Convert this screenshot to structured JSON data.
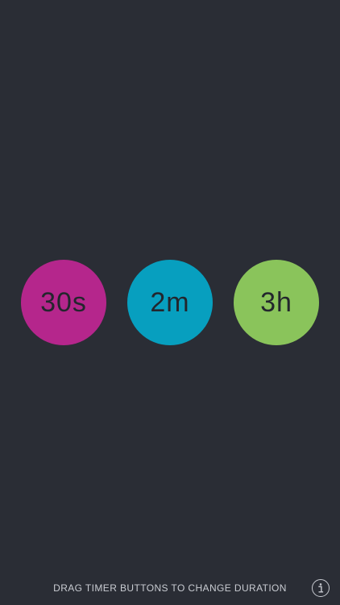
{
  "timers": [
    {
      "label": "30s",
      "color": "#b5268c"
    },
    {
      "label": "2m",
      "color": "#079fbf"
    },
    {
      "label": "3h",
      "color": "#8ac45b"
    }
  ],
  "footer": {
    "hint": "DRAG TIMER BUTTONS TO CHANGE DURATION",
    "info_icon": "info-icon"
  },
  "colors": {
    "background": "#2a2d35",
    "label_text": "#23262d",
    "hint_text": "#c9ccd2"
  }
}
